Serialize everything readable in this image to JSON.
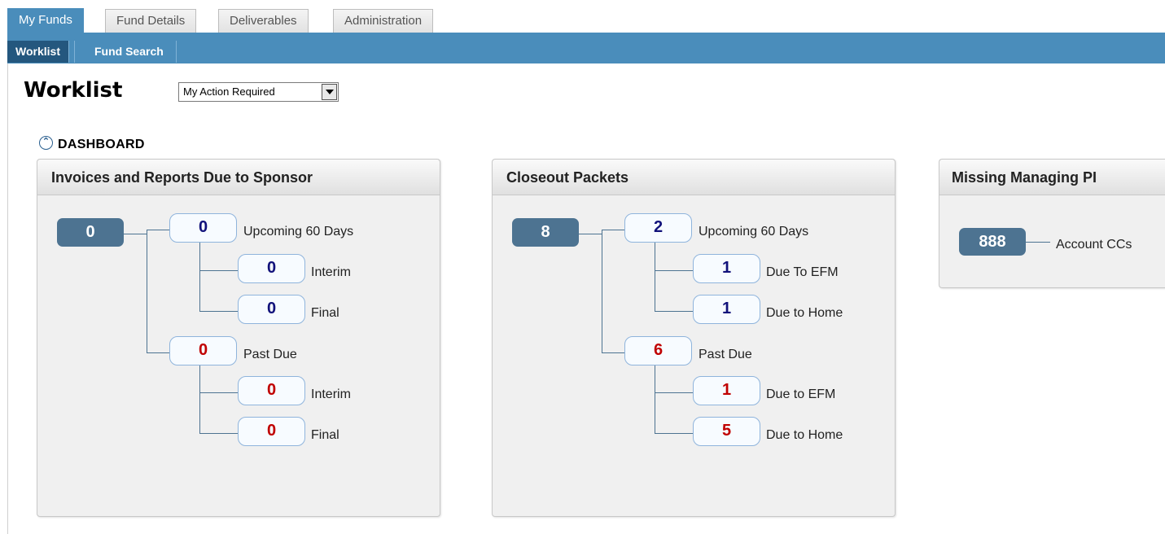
{
  "top_tabs": [
    "My Funds",
    "Fund Details",
    "Deliverables",
    "Administration"
  ],
  "sub_tabs": [
    "Worklist",
    "Fund Search"
  ],
  "page_title": "Worklist",
  "view_select": {
    "selected": "My Action Required"
  },
  "dashboard": {
    "label": "DASHBOARD",
    "toggle_icon": "collapse-up-icon"
  },
  "colors": {
    "accent": "#4a8dbb",
    "active_subtab": "#24577e",
    "count_blue": "#11117a",
    "count_red": "#c00000",
    "total_badge": "#4d7391"
  },
  "panels": {
    "invoices": {
      "title": "Invoices and Reports Due to Sponsor",
      "total": "0",
      "upcoming": {
        "value": "0",
        "label": "Upcoming 60 Days",
        "children": [
          {
            "value": "0",
            "label": "Interim"
          },
          {
            "value": "0",
            "label": "Final"
          }
        ]
      },
      "past_due": {
        "value": "0",
        "label": "Past Due",
        "children": [
          {
            "value": "0",
            "label": "Interim"
          },
          {
            "value": "0",
            "label": "Final"
          }
        ]
      }
    },
    "closeout": {
      "title": "Closeout Packets",
      "total": "8",
      "upcoming": {
        "value": "2",
        "label": "Upcoming 60 Days",
        "children": [
          {
            "value": "1",
            "label": "Due To EFM"
          },
          {
            "value": "1",
            "label": "Due to Home"
          }
        ]
      },
      "past_due": {
        "value": "6",
        "label": "Past Due",
        "children": [
          {
            "value": "1",
            "label": "Due to EFM"
          },
          {
            "value": "5",
            "label": "Due to Home"
          }
        ]
      }
    },
    "missing_pi": {
      "title": "Missing Managing PI",
      "total": "888",
      "label": "Account CCs"
    }
  }
}
